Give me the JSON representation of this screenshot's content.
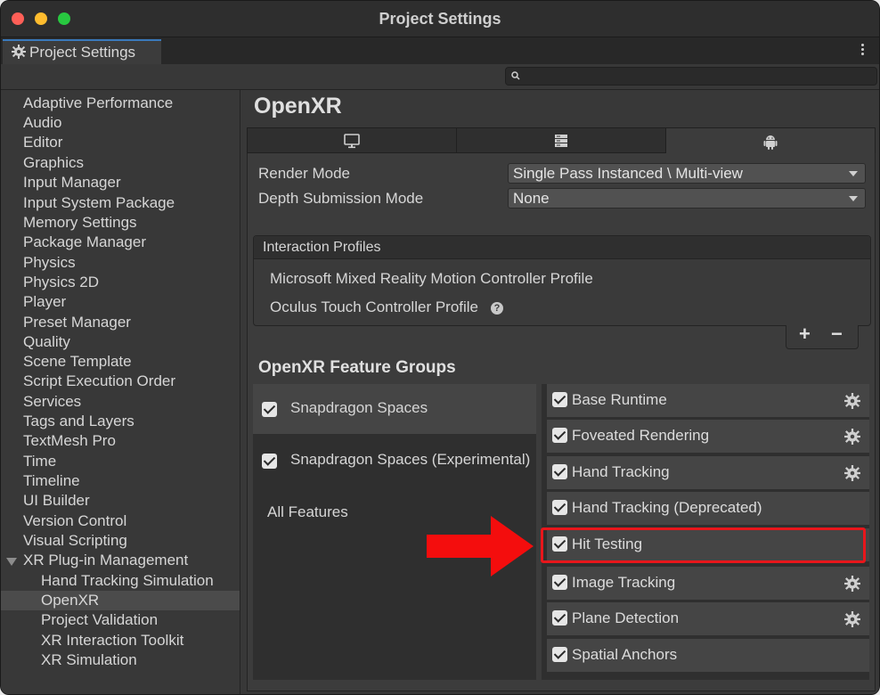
{
  "window": {
    "title": "Project Settings"
  },
  "tab": {
    "label": "Project Settings"
  },
  "sidebar": {
    "items": [
      {
        "label": "Adaptive Performance"
      },
      {
        "label": "Audio"
      },
      {
        "label": "Editor"
      },
      {
        "label": "Graphics"
      },
      {
        "label": "Input Manager"
      },
      {
        "label": "Input System Package"
      },
      {
        "label": "Memory Settings"
      },
      {
        "label": "Package Manager"
      },
      {
        "label": "Physics"
      },
      {
        "label": "Physics 2D"
      },
      {
        "label": "Player"
      },
      {
        "label": "Preset Manager"
      },
      {
        "label": "Quality"
      },
      {
        "label": "Scene Template"
      },
      {
        "label": "Script Execution Order"
      },
      {
        "label": "Services"
      },
      {
        "label": "Tags and Layers"
      },
      {
        "label": "TextMesh Pro"
      },
      {
        "label": "Time"
      },
      {
        "label": "Timeline"
      },
      {
        "label": "UI Builder"
      },
      {
        "label": "Version Control"
      },
      {
        "label": "Visual Scripting"
      },
      {
        "label": "XR Plug-in Management"
      }
    ],
    "children": [
      {
        "label": "Hand Tracking Simulation"
      },
      {
        "label": "OpenXR",
        "selected": true
      },
      {
        "label": "Project Validation"
      },
      {
        "label": "XR Interaction Toolkit"
      },
      {
        "label": "XR Simulation"
      }
    ]
  },
  "main": {
    "heading": "OpenXR",
    "platform_tabs": [
      {
        "icon": "monitor-icon"
      },
      {
        "icon": "server-icon"
      },
      {
        "icon": "android-icon",
        "active": true
      }
    ],
    "render_mode": {
      "label": "Render Mode",
      "value": "Single Pass Instanced \\ Multi-view"
    },
    "depth_mode": {
      "label": "Depth Submission Mode",
      "value": "None"
    },
    "interaction_profiles": {
      "title": "Interaction Profiles",
      "items": [
        {
          "label": "Microsoft Mixed Reality Motion Controller Profile"
        },
        {
          "label": "Oculus Touch Controller Profile"
        }
      ],
      "add": "+",
      "remove": "−"
    },
    "feature_groups": {
      "title": "OpenXR Feature Groups",
      "groups": [
        {
          "label": "Snapdragon Spaces",
          "checked": true,
          "selected": true
        },
        {
          "label": "Snapdragon Spaces (Experimental)",
          "checked": true
        },
        {
          "label": "All Features"
        }
      ],
      "features": [
        {
          "label": "Base Runtime",
          "checked": true,
          "settings": true
        },
        {
          "label": "Foveated Rendering",
          "checked": true,
          "settings": true
        },
        {
          "label": "Hand Tracking",
          "checked": true,
          "settings": true
        },
        {
          "label": "Hand Tracking (Deprecated)",
          "checked": true,
          "settings": false
        },
        {
          "label": "Hit Testing",
          "checked": true,
          "settings": false,
          "highlighted": true
        },
        {
          "label": "Image Tracking",
          "checked": true,
          "settings": true
        },
        {
          "label": "Plane Detection",
          "checked": true,
          "settings": true
        },
        {
          "label": "Spatial Anchors",
          "checked": true,
          "settings": false
        }
      ]
    }
  },
  "colors": {
    "highlight": "#e8161b",
    "arrow": "#f40d0d"
  }
}
